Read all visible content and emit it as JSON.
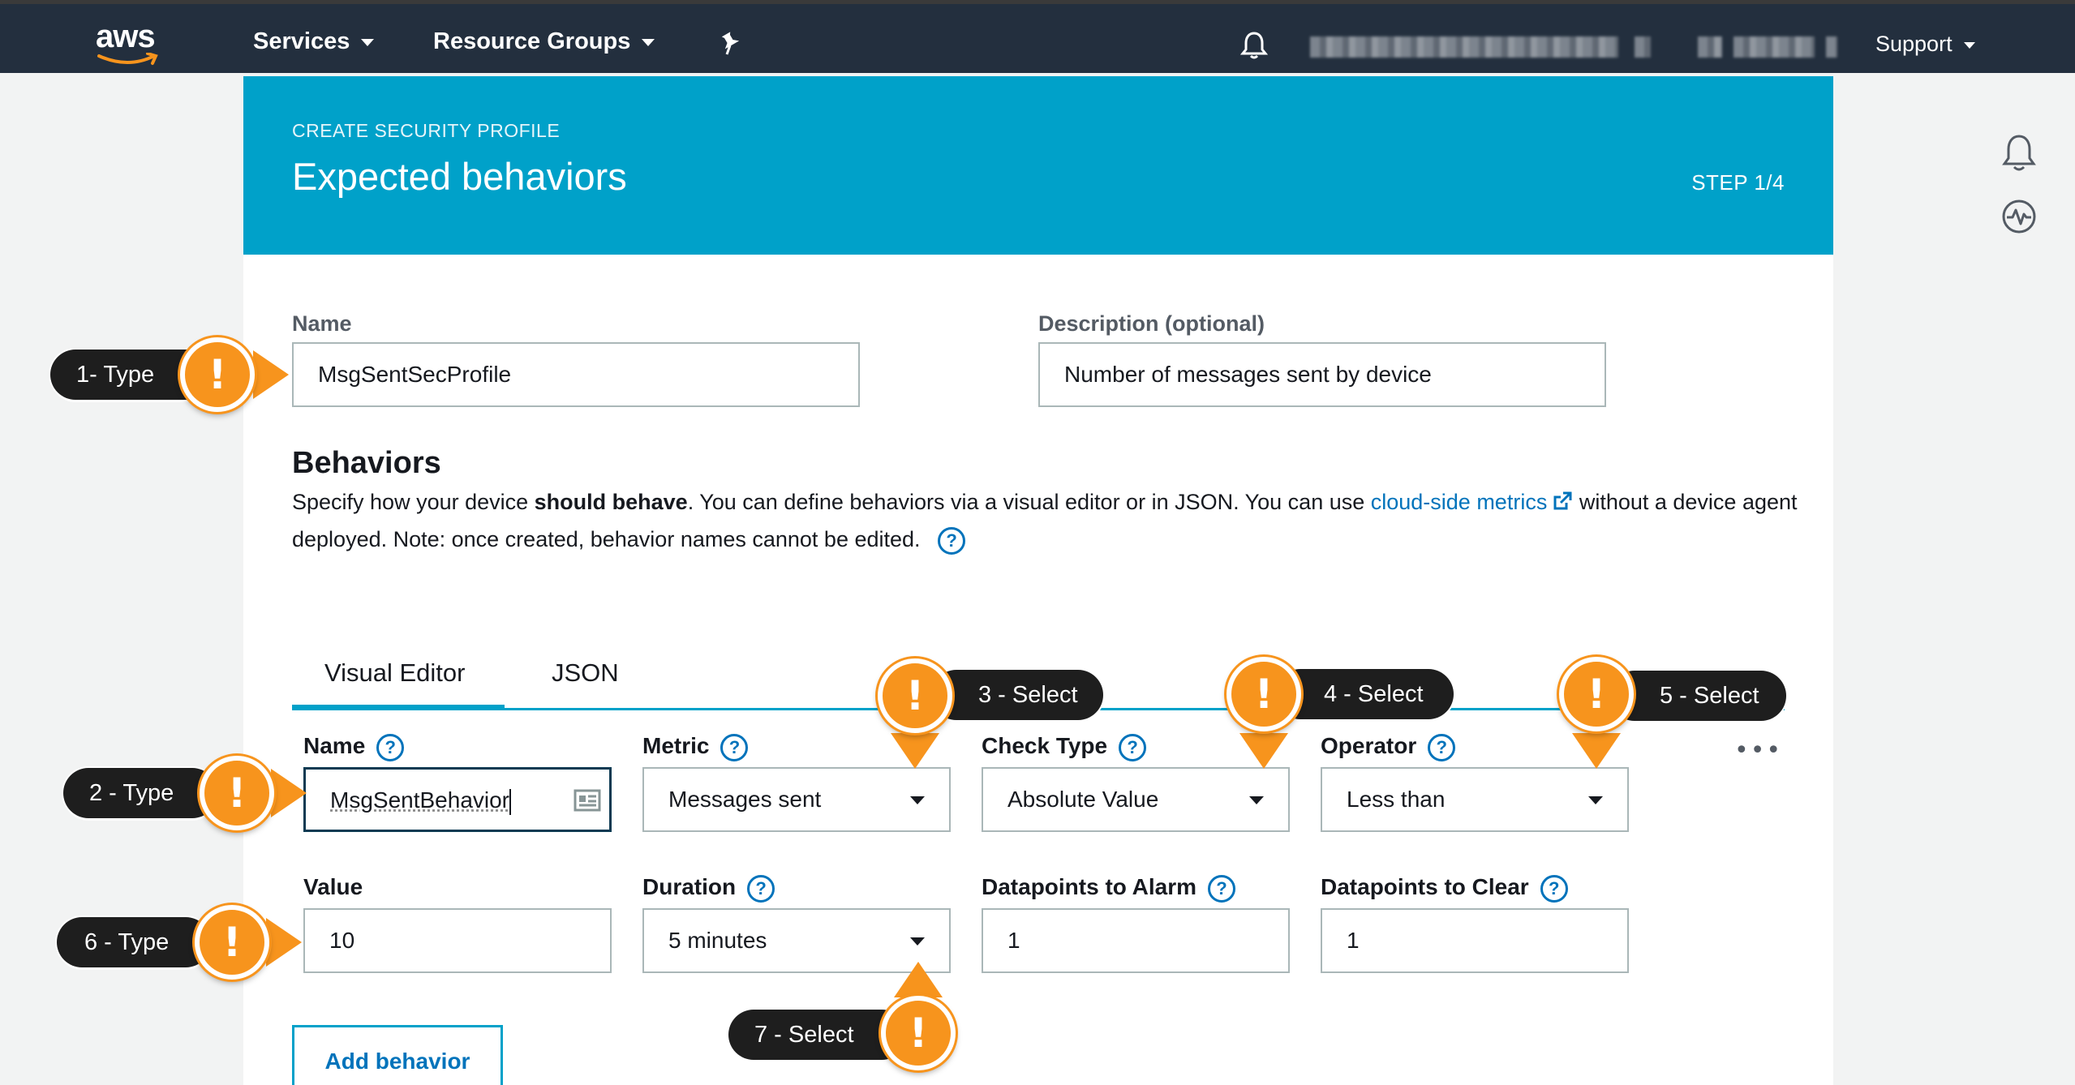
{
  "topnav": {
    "logo_text": "aws",
    "services": "Services",
    "resource_groups": "Resource Groups",
    "support": "Support"
  },
  "banner": {
    "subtitle": "CREATE SECURITY PROFILE",
    "title": "Expected behaviors",
    "step": "STEP 1/4"
  },
  "profile": {
    "name_label": "Name",
    "name_value": "MsgSentSecProfile",
    "description_label": "Description (optional)",
    "description_value": "Number of messages sent by device"
  },
  "behaviors": {
    "heading": "Behaviors",
    "para_part1": "Specify how your device ",
    "para_bold": "should behave",
    "para_part2": ". You can define behaviors via a visual editor or in JSON. You can use ",
    "para_link": "cloud-side metrics",
    "para_part3": " without a device agent deployed. Note: once created, behavior names cannot be edited.",
    "tabs": [
      "Visual Editor",
      "JSON"
    ]
  },
  "form": {
    "name_label": "Name",
    "name_value": "MsgSentBehavior",
    "metric_label": "Metric",
    "metric_value": "Messages sent",
    "check_type_label": "Check Type",
    "check_type_value": "Absolute Value",
    "operator_label": "Operator",
    "operator_value": "Less than",
    "value_label": "Value",
    "value_value": "10",
    "duration_label": "Duration",
    "duration_value": "5 minutes",
    "dp_alarm_label": "Datapoints to Alarm",
    "dp_alarm_value": "1",
    "dp_clear_label": "Datapoints to Clear",
    "dp_clear_value": "1",
    "add_behavior": "Add behavior",
    "more": "•••"
  },
  "callouts": {
    "c1": "1- Type",
    "c2": "2 - Type",
    "c3": "3 - Select",
    "c4": "4 - Select",
    "c5": "5 - Select",
    "c6": "6 - Type",
    "c7": "7 - Select"
  },
  "colors": {
    "nav_bg": "#232f3e",
    "banner_bg": "#00a1c9",
    "callout_orange": "#f7941d",
    "link_blue": "#0073bb"
  }
}
